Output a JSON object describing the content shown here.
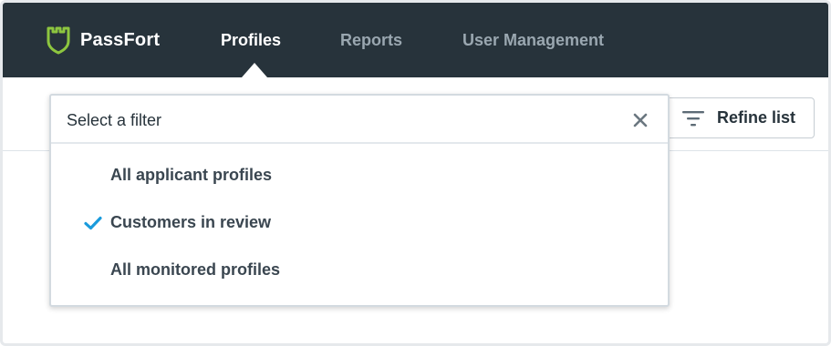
{
  "app": {
    "brand_name": "PassFort",
    "brand_color": "#8dc63f"
  },
  "nav": {
    "items": [
      {
        "label": "Profiles",
        "active": true
      },
      {
        "label": "Reports",
        "active": false
      },
      {
        "label": "User Management",
        "active": false
      }
    ]
  },
  "toolbar": {
    "refine_label": "Refine list",
    "refine_icon": "filter-icon"
  },
  "filter_dropdown": {
    "title": "Select a filter",
    "close_icon": "close-icon",
    "check_color": "#1a9bdc",
    "options": [
      {
        "label": "All applicant profiles",
        "selected": false
      },
      {
        "label": "Customers in review",
        "selected": true
      },
      {
        "label": "All monitored profiles",
        "selected": false
      }
    ]
  },
  "colors": {
    "navbar_bg": "#27333b",
    "nav_active": "#ffffff",
    "nav_inactive": "#9aa7b0"
  }
}
